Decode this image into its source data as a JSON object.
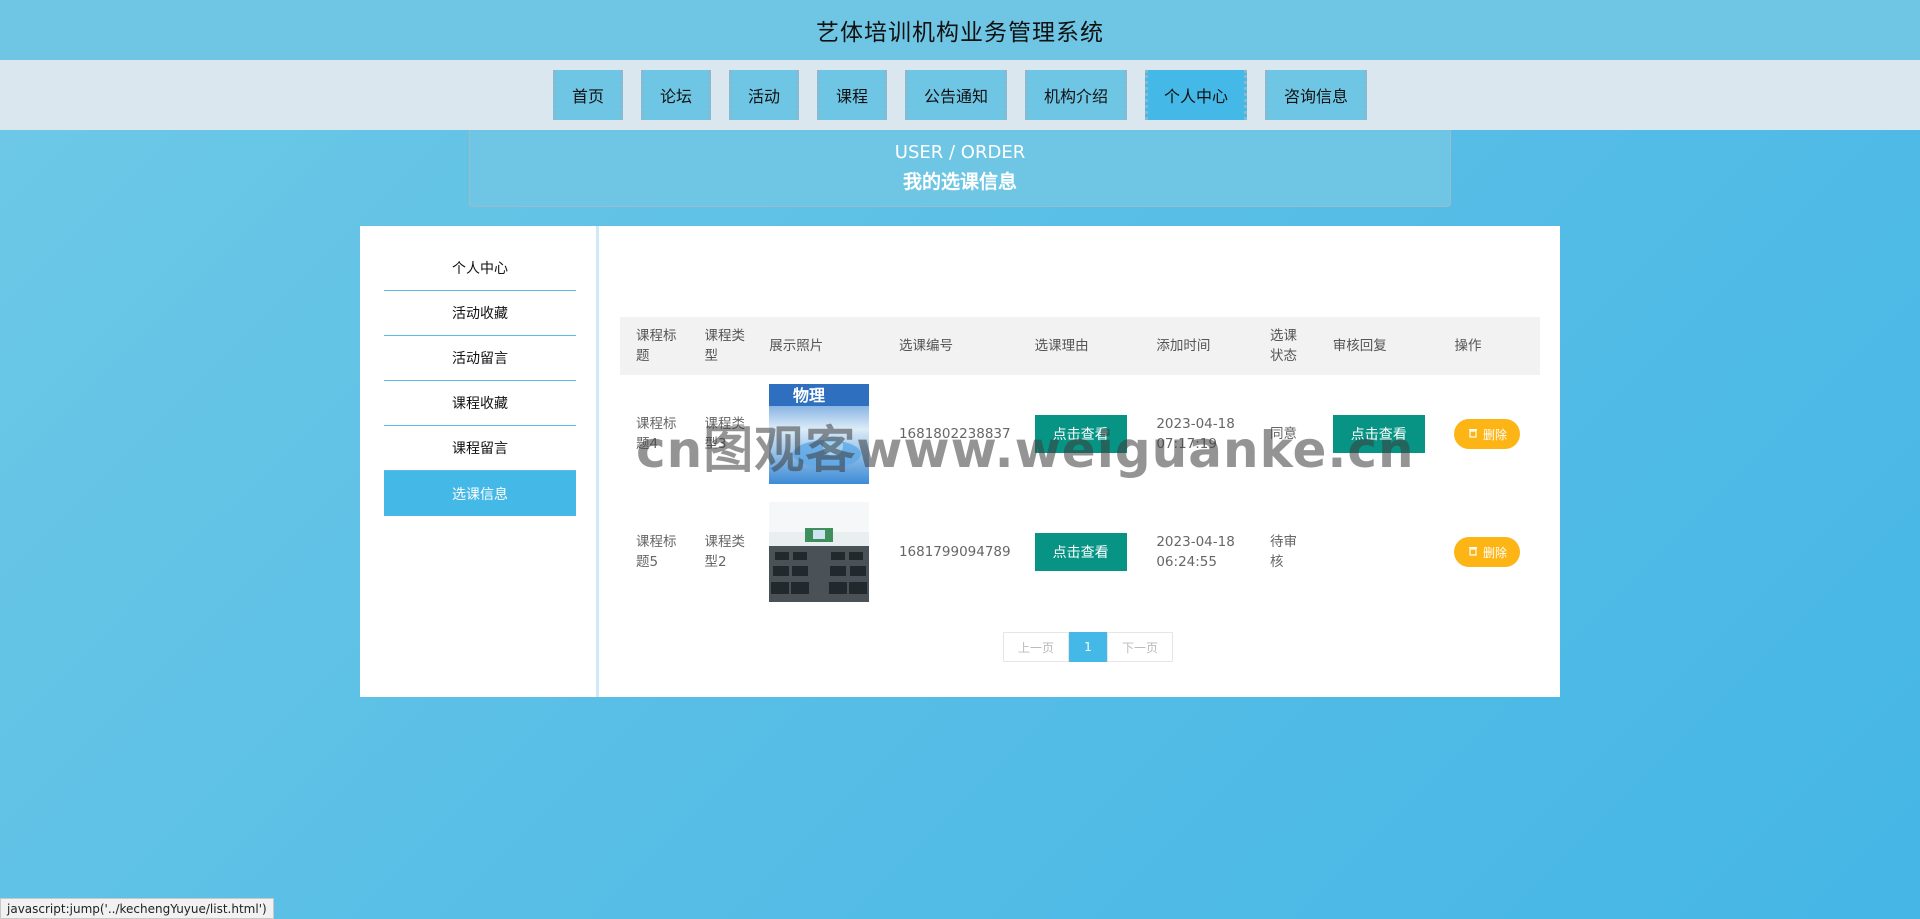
{
  "header": {
    "title": "艺体培训机构业务管理系统"
  },
  "nav": [
    {
      "label": "首页"
    },
    {
      "label": "论坛"
    },
    {
      "label": "活动"
    },
    {
      "label": "课程"
    },
    {
      "label": "公告通知"
    },
    {
      "label": "机构介绍"
    },
    {
      "label": "个人中心",
      "active": true
    },
    {
      "label": "咨询信息"
    }
  ],
  "banner": {
    "en": "USER / ORDER",
    "cn": "我的选课信息"
  },
  "sidebar": [
    {
      "label": "个人中心"
    },
    {
      "label": "活动收藏"
    },
    {
      "label": "活动留言"
    },
    {
      "label": "课程收藏"
    },
    {
      "label": "课程留言"
    },
    {
      "label": "选课信息",
      "active": true
    }
  ],
  "table": {
    "columns": [
      "课程标题",
      "课程类型",
      "展示照片",
      "选课编号",
      "选课理由",
      "添加时间",
      "选课状态",
      "审核回复",
      "操作"
    ],
    "rows": [
      {
        "title": "课程标题4",
        "type": "课程类型3",
        "photo": "physics-book-cover",
        "code": "1681802238837",
        "reason_btn": "点击查看",
        "time": "2023-04-18 07:17:19",
        "status": "同意",
        "reply_btn": "点击查看",
        "delete": "删除"
      },
      {
        "title": "课程标题5",
        "type": "课程类型2",
        "photo": "classroom",
        "code": "1681799094789",
        "reason_btn": "点击查看",
        "time": "2023-04-18 06:24:55",
        "status": "待审核",
        "reply_btn": "",
        "delete": "删除"
      }
    ]
  },
  "pager": {
    "prev": "上一页",
    "current": "1",
    "next": "下一页"
  },
  "watermark": "cn图观客www.weiguanke.cn",
  "statusbar": "javascript:jump('../kechengYuyue/list.html')",
  "colors": {
    "accent": "#44b8e6",
    "green": "#079485",
    "delete": "#fdb415"
  }
}
